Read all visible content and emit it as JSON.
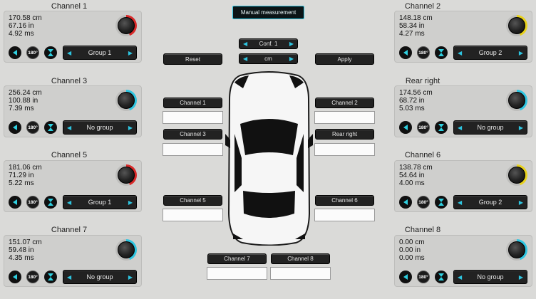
{
  "header": {
    "manual_label": "Manual measurement"
  },
  "controls": {
    "conf_label": "Conf. 1",
    "unit_label": "cm",
    "reset_label": "Reset",
    "apply_label": "Apply"
  },
  "delay_buttons": {
    "ch1": "Channel 1",
    "ch2": "Channel 2",
    "ch3": "Channel 3",
    "ch4": "Rear right",
    "ch5": "Channel 5",
    "ch6": "Channel 6",
    "ch7": "Channel 7",
    "ch8": "Channel 8"
  },
  "icons": {
    "phase_label": "180°"
  },
  "channels": [
    {
      "title": "Channel 1",
      "cm": "170.58 cm",
      "inch": "67.16 in",
      "ms": "4.92 ms",
      "group": "Group 1",
      "knob_color": "#d92a2a"
    },
    {
      "title": "Channel 2",
      "cm": "148.18 cm",
      "inch": "58.34 in",
      "ms": "4.27 ms",
      "group": "Group 2",
      "knob_color": "#e8d21c"
    },
    {
      "title": "Channel 3",
      "cm": "256.24 cm",
      "inch": "100.88 in",
      "ms": "7.39 ms",
      "group": "No group",
      "knob_color": "#2ec5e0"
    },
    {
      "title": "Rear right",
      "cm": "174.56 cm",
      "inch": "68.72 in",
      "ms": "5.03 ms",
      "group": "No group",
      "knob_color": "#2ec5e0"
    },
    {
      "title": "Channel 5",
      "cm": "181.06 cm",
      "inch": "71.29 in",
      "ms": "5.22 ms",
      "group": "Group 1",
      "knob_color": "#d92a2a"
    },
    {
      "title": "Channel 6",
      "cm": "138.78 cm",
      "inch": "54.64 in",
      "ms": "4.00 ms",
      "group": "Group 2",
      "knob_color": "#e8d21c"
    },
    {
      "title": "Channel 7",
      "cm": "151.07 cm",
      "inch": "59.48 in",
      "ms": "4.35 ms",
      "group": "No group",
      "knob_color": "#2ec5e0"
    },
    {
      "title": "Channel 8",
      "cm": "0.00 cm",
      "inch": "0.00 in",
      "ms": "0.00 ms",
      "group": "No group",
      "knob_color": "#2ec5e0"
    }
  ]
}
